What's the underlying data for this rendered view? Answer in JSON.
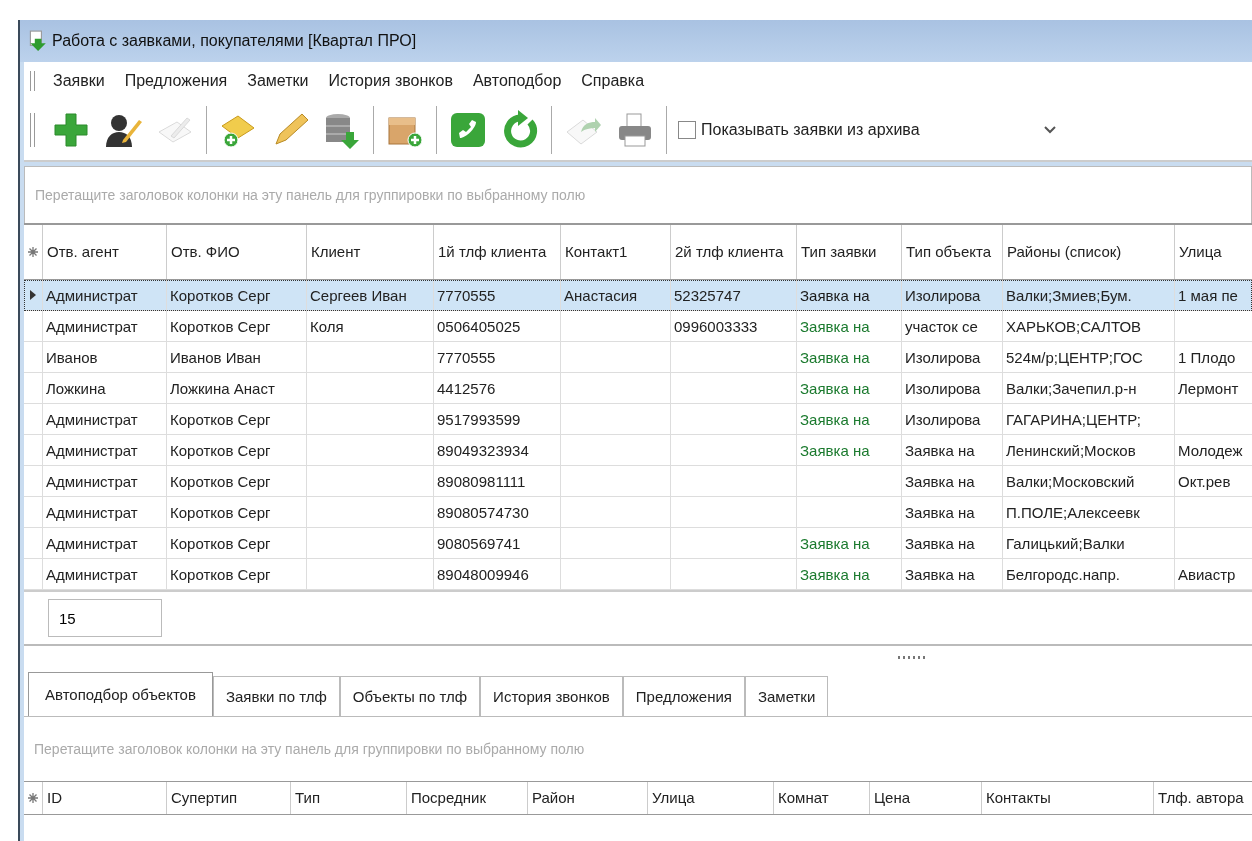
{
  "window": {
    "title": "Работа с заявками, покупателями [Квартал ПРО]"
  },
  "menu": [
    "Заявки",
    "Предложения",
    "Заметки",
    "История звонков",
    "Автоподбор",
    "Справка"
  ],
  "toolbar": {
    "buttons": [
      {
        "kind": "add",
        "disabled": false
      },
      {
        "kind": "user-edit",
        "disabled": false
      },
      {
        "kind": "sign",
        "disabled": true
      },
      {
        "kind": "note-add",
        "disabled": false
      },
      {
        "kind": "pencil",
        "disabled": false
      },
      {
        "kind": "database",
        "disabled": false
      },
      {
        "kind": "box-add",
        "disabled": false
      },
      {
        "kind": "phone",
        "disabled": false
      },
      {
        "kind": "refresh",
        "disabled": false
      },
      {
        "kind": "export",
        "disabled": true
      },
      {
        "kind": "printer",
        "disabled": false
      }
    ],
    "archive_checkbox": {
      "label": "Показывать заявки из архива",
      "checked": false
    }
  },
  "group_panel": {
    "placeholder": "Перетащите заголовок колонки на эту панель для группировки по выбранному полю"
  },
  "table": {
    "columns": [
      "Отв. агент",
      "Отв. ФИО",
      "Клиент",
      "1й тлф клиента",
      "Контакт1",
      "2й тлф клиента",
      "Тип заявки",
      "Тип объекта",
      "Районы (список)",
      "Улица"
    ],
    "rows": [
      {
        "selected": true,
        "cells": [
          "Администрат",
          "Коротков Серг",
          "Сергеев Иван",
          "7770555",
          "Анастасия",
          "52325747",
          {
            "text": "Заявка на",
            "color": "#1a1a1a"
          },
          "Изолирова",
          "Валки;Змиев;Бум.",
          "1 мая пе"
        ]
      },
      {
        "selected": false,
        "cells": [
          "Администрат",
          "Коротков Серг",
          "Коля",
          "0506405025",
          "",
          "0996003333",
          {
            "text": "Заявка на",
            "color": "#1b7a2e"
          },
          "участок се",
          "ХАРЬКОВ;САЛТОВ",
          ""
        ]
      },
      {
        "selected": false,
        "cells": [
          "Иванов",
          "Иванов Иван",
          "",
          "7770555",
          "",
          "",
          {
            "text": "Заявка на",
            "color": "#1b7a2e"
          },
          "Изолирова",
          "524м/р;ЦЕНТР;ГОС",
          "1 Плодо"
        ]
      },
      {
        "selected": false,
        "cells": [
          "Ложкина",
          "Ложкина Анаст",
          "",
          "4412576",
          "",
          "",
          {
            "text": "Заявка на",
            "color": "#1b7a2e"
          },
          "Изолирова",
          "Валки;Зачепил.р-н",
          "Лермонт"
        ]
      },
      {
        "selected": false,
        "cells": [
          "Администрат",
          "Коротков Серг",
          "",
          "9517993599",
          "",
          "",
          {
            "text": "Заявка на",
            "color": "#1b7a2e"
          },
          "Изолирова",
          "ГАГАРИНА;ЦЕНТР;",
          ""
        ]
      },
      {
        "selected": false,
        "cells": [
          "Администрат",
          "Коротков Серг",
          "",
          "89049323934",
          "",
          "",
          {
            "text": "Заявка на",
            "color": "#1b7a2e"
          },
          "Заявка на",
          "Ленинский;Москов",
          "Молодеж"
        ]
      },
      {
        "selected": false,
        "cells": [
          "Администрат",
          "Коротков Серг",
          "",
          "89080981111",
          "",
          "",
          "",
          "Заявка на",
          "Валки;Московский",
          "Окт.рев"
        ]
      },
      {
        "selected": false,
        "cells": [
          "Администрат",
          "Коротков Серг",
          "",
          "89080574730",
          "",
          "",
          "",
          "Заявка на",
          "П.ПОЛЕ;Алексеевк",
          ""
        ]
      },
      {
        "selected": false,
        "cells": [
          "Администрат",
          "Коротков Серг",
          "",
          "9080569741",
          "",
          "",
          {
            "text": "Заявка на",
            "color": "#1b7a2e"
          },
          "Заявка на",
          "Галицький;Валки",
          ""
        ]
      },
      {
        "selected": false,
        "cells": [
          "Администрат",
          "Коротков Серг",
          "",
          "89048009946",
          "",
          "",
          {
            "text": "Заявка на",
            "color": "#1b7a2e"
          },
          "Заявка на",
          "Белгородс.напр.",
          "Авиастр"
        ]
      }
    ]
  },
  "count_field": {
    "value": "15"
  },
  "tabs": [
    {
      "label": "Автоподбор объектов",
      "selected": true
    },
    {
      "label": "Заявки по тлф",
      "selected": false
    },
    {
      "label": "Объекты по тлф",
      "selected": false
    },
    {
      "label": "История звонков",
      "selected": false
    },
    {
      "label": "Предложения",
      "selected": false
    },
    {
      "label": "Заметки",
      "selected": false
    }
  ],
  "lower_group_panel": {
    "placeholder": "Перетащите заголовок колонки на эту панель для группировки по выбранному полю"
  },
  "lower_table": {
    "columns": [
      "ID",
      "Супертип",
      "Тип",
      "Посредник",
      "Район",
      "Улица",
      "Комнат",
      "Цена",
      "Контакты",
      "Тлф. автора"
    ]
  }
}
